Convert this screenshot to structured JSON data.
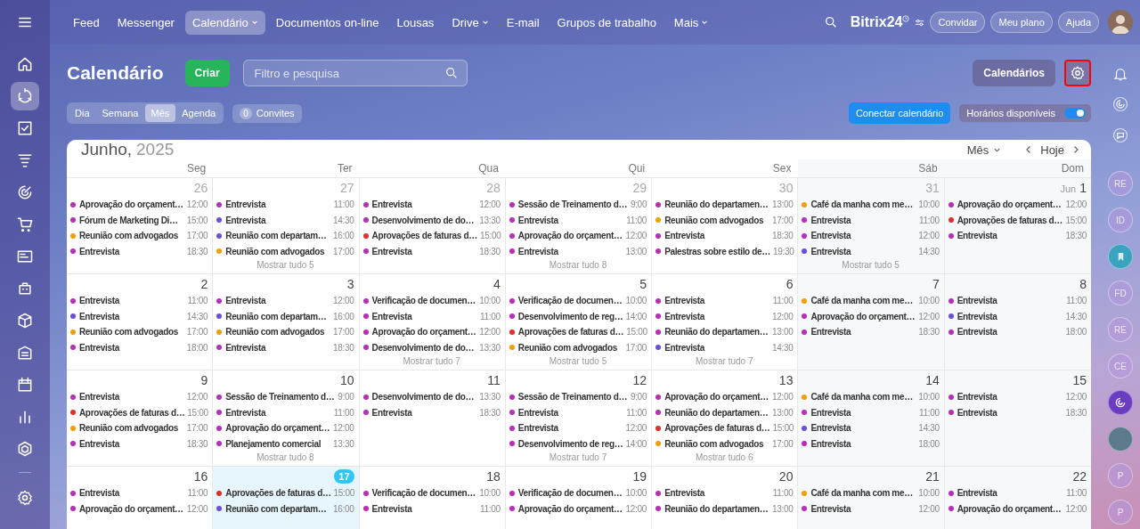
{
  "top_nav": {
    "items": [
      {
        "label": "Feed",
        "selected": false,
        "dropdown": false
      },
      {
        "label": "Messenger",
        "selected": false,
        "dropdown": false
      },
      {
        "label": "Calendário",
        "selected": true,
        "dropdown": true
      },
      {
        "label": "Documentos on-line",
        "selected": false,
        "dropdown": false
      },
      {
        "label": "Lousas",
        "selected": false,
        "dropdown": false
      },
      {
        "label": "Drive",
        "selected": false,
        "dropdown": true
      },
      {
        "label": "E-mail",
        "selected": false,
        "dropdown": false
      },
      {
        "label": "Grupos de trabalho",
        "selected": false,
        "dropdown": false
      },
      {
        "label": "Mais",
        "selected": false,
        "dropdown": true
      }
    ]
  },
  "logo": {
    "name": "Bitrix",
    "suffix": "24"
  },
  "header_buttons": [
    "Convidar",
    "Meu plano",
    "Ajuda"
  ],
  "left_sidebar": {
    "items": [
      {
        "selected": false
      },
      {
        "selected": true
      },
      {
        "selected": false
      },
      {
        "selected": false
      },
      {
        "selected": false
      },
      {
        "selected": false
      },
      {
        "selected": false
      },
      {
        "selected": false
      },
      {
        "selected": false
      },
      {
        "selected": false
      },
      {
        "selected": false
      },
      {
        "selected": false
      },
      {
        "selected": false
      }
    ]
  },
  "page": {
    "title": "Calendário",
    "create_button": "Criar",
    "search": {
      "placeholder": "Filtro e pesquisa"
    },
    "calendars_button": "Calendários",
    "views": [
      {
        "label": "Dia",
        "selected": false
      },
      {
        "label": "Semana",
        "selected": false
      },
      {
        "label": "Mês",
        "selected": true
      },
      {
        "label": "Agenda",
        "selected": false
      }
    ],
    "invites": {
      "count": "0",
      "label": "Convites"
    },
    "connect_button": "Conectar calendário",
    "availability": {
      "label": "Horários disponíveis",
      "on": true
    }
  },
  "calendar": {
    "month": "Junho,",
    "year": "2025",
    "view_select": "Mês",
    "today_button": "Hoje",
    "weekdays": [
      "Seg",
      "Ter",
      "Qua",
      "Qui",
      "Sex",
      "Sáb",
      "Dom"
    ],
    "weeks": [
      {
        "days": [
          {
            "date": "26",
            "other_month": true,
            "today": false,
            "events": [
              {
                "title": "Aprovação do orçament…",
                "time": "12:00",
                "color": "#b62fb8"
              },
              {
                "title": "Fórum de Marketing Di…",
                "time": "15:00",
                "color": "#b62fb8"
              },
              {
                "title": "Reunião com advogados",
                "time": "17:00",
                "color": "#f0a000"
              },
              {
                "title": "Entrevista",
                "time": "18:30",
                "color": "#b62fb8"
              }
            ]
          },
          {
            "date": "27",
            "other_month": true,
            "today": false,
            "events": [
              {
                "title": "Entrevista",
                "time": "11:00",
                "color": "#b62fb8"
              },
              {
                "title": "Entrevista",
                "time": "14:30",
                "color": "#6a4fd8"
              },
              {
                "title": "Reunião com departam…",
                "time": "16:00",
                "color": "#6a4fd8"
              },
              {
                "title": "Reunião com advogados",
                "time": "17:00",
                "color": "#f0a000"
              }
            ],
            "more": "Mostrar tudo 5"
          },
          {
            "date": "28",
            "other_month": true,
            "today": false,
            "events": [
              {
                "title": "Entrevista",
                "time": "12:00",
                "color": "#b62fb8"
              },
              {
                "title": "Desenvolvimento de do…",
                "time": "13:30",
                "color": "#b62fb8"
              },
              {
                "title": "Aprovações de faturas d…",
                "time": "15:00",
                "color": "#e0302a"
              },
              {
                "title": "Entrevista",
                "time": "18:30",
                "color": "#b62fb8"
              }
            ]
          },
          {
            "date": "29",
            "other_month": true,
            "today": false,
            "events": [
              {
                "title": "Sessão de Treinamento d…",
                "time": "9:00",
                "color": "#b62fb8"
              },
              {
                "title": "Entrevista",
                "time": "11:00",
                "color": "#b62fb8"
              },
              {
                "title": "Aprovação do orçament…",
                "time": "12:00",
                "color": "#b62fb8"
              },
              {
                "title": "Entrevista",
                "time": "13:00",
                "color": "#b62fb8"
              }
            ],
            "more": "Mostrar tudo 8"
          },
          {
            "date": "30",
            "other_month": true,
            "today": false,
            "events": [
              {
                "title": "Reunião do departamen…",
                "time": "13:00",
                "color": "#b62fb8"
              },
              {
                "title": "Reunião com advogados",
                "time": "17:00",
                "color": "#f0a000"
              },
              {
                "title": "Entrevista",
                "time": "18:30",
                "color": "#b62fb8"
              },
              {
                "title": "Palestras sobre estilo de…",
                "time": "19:30",
                "color": "#b62fb8"
              }
            ]
          },
          {
            "date": "31",
            "other_month": true,
            "today": false,
            "events": [
              {
                "title": "Café da manha com me…",
                "time": "10:00",
                "color": "#f0a000"
              },
              {
                "title": "Entrevista",
                "time": "11:00",
                "color": "#b62fb8"
              },
              {
                "title": "Entrevista",
                "time": "12:00",
                "color": "#b62fb8"
              },
              {
                "title": "Entrevista",
                "time": "14:30",
                "color": "#6a4fd8"
              }
            ],
            "more": "Mostrar tudo 5"
          },
          {
            "month_label": "Jun",
            "date": "1",
            "other_month": false,
            "today": false,
            "events": [
              {
                "title": "Aprovação do orçament…",
                "time": "12:00",
                "color": "#b62fb8"
              },
              {
                "title": "Aprovações de faturas d…",
                "time": "15:00",
                "color": "#e0302a"
              },
              {
                "title": "Entrevista",
                "time": "18:30",
                "color": "#b62fb8"
              }
            ]
          }
        ]
      },
      {
        "days": [
          {
            "date": "2",
            "other_month": false,
            "today": false,
            "events": [
              {
                "title": "Entrevista",
                "time": "11:00",
                "color": "#b62fb8"
              },
              {
                "title": "Entrevista",
                "time": "14:30",
                "color": "#6a4fd8"
              },
              {
                "title": "Reunião com advogados",
                "time": "17:00",
                "color": "#f0a000"
              },
              {
                "title": "Entrevista",
                "time": "18:00",
                "color": "#b62fb8"
              }
            ]
          },
          {
            "date": "3",
            "other_month": false,
            "today": false,
            "events": [
              {
                "title": "Entrevista",
                "time": "12:00",
                "color": "#b62fb8"
              },
              {
                "title": "Reunião com departam…",
                "time": "16:00",
                "color": "#6a4fd8"
              },
              {
                "title": "Reunião com advogados",
                "time": "17:00",
                "color": "#f0a000"
              },
              {
                "title": "Entrevista",
                "time": "18:30",
                "color": "#b62fb8"
              }
            ]
          },
          {
            "date": "4",
            "other_month": false,
            "today": false,
            "events": [
              {
                "title": "Verificação de documen…",
                "time": "10:00",
                "color": "#b62fb8"
              },
              {
                "title": "Entrevista",
                "time": "11:00",
                "color": "#b62fb8"
              },
              {
                "title": "Aprovação do orçament…",
                "time": "12:00",
                "color": "#b62fb8"
              },
              {
                "title": "Desenvolvimento de do…",
                "time": "13:30",
                "color": "#b62fb8"
              }
            ],
            "more": "Mostrar tudo 7"
          },
          {
            "date": "5",
            "other_month": false,
            "today": false,
            "events": [
              {
                "title": "Verificação de documen…",
                "time": "10:00",
                "color": "#b62fb8"
              },
              {
                "title": "Desenvolvimento de reg…",
                "time": "14:00",
                "color": "#b62fb8"
              },
              {
                "title": "Aprovações de faturas d…",
                "time": "15:00",
                "color": "#e0302a"
              },
              {
                "title": "Reunião com advogados",
                "time": "17:00",
                "color": "#f0a000"
              }
            ],
            "more": "Mostrar tudo 5"
          },
          {
            "date": "6",
            "other_month": false,
            "today": false,
            "events": [
              {
                "title": "Entrevista",
                "time": "11:00",
                "color": "#b62fb8"
              },
              {
                "title": "Entrevista",
                "time": "12:00",
                "color": "#b62fb8"
              },
              {
                "title": "Reunião do departamen…",
                "time": "13:00",
                "color": "#b62fb8"
              },
              {
                "title": "Entrevista",
                "time": "14:30",
                "color": "#6a4fd8"
              }
            ],
            "more": "Mostrar tudo 7"
          },
          {
            "date": "7",
            "other_month": false,
            "today": false,
            "events": [
              {
                "title": "Café da manha com me…",
                "time": "10:00",
                "color": "#f0a000"
              },
              {
                "title": "Aprovação do orçament…",
                "time": "12:00",
                "color": "#b62fb8"
              },
              {
                "title": "Entrevista",
                "time": "18:30",
                "color": "#b62fb8"
              }
            ]
          },
          {
            "date": "8",
            "other_month": false,
            "today": false,
            "events": [
              {
                "title": "Entrevista",
                "time": "11:00",
                "color": "#b62fb8"
              },
              {
                "title": "Entrevista",
                "time": "14:30",
                "color": "#6a4fd8"
              },
              {
                "title": "Entrevista",
                "time": "18:00",
                "color": "#b62fb8"
              }
            ]
          }
        ]
      },
      {
        "days": [
          {
            "date": "9",
            "other_month": false,
            "today": false,
            "events": [
              {
                "title": "Entrevista",
                "time": "12:00",
                "color": "#b62fb8"
              },
              {
                "title": "Aprovações de faturas d…",
                "time": "15:00",
                "color": "#e0302a"
              },
              {
                "title": "Reunião com advogados",
                "time": "17:00",
                "color": "#f0a000"
              },
              {
                "title": "Entrevista",
                "time": "18:30",
                "color": "#b62fb8"
              }
            ]
          },
          {
            "date": "10",
            "other_month": false,
            "today": false,
            "events": [
              {
                "title": "Sessão de Treinamento d…",
                "time": "9:00",
                "color": "#b62fb8"
              },
              {
                "title": "Entrevista",
                "time": "11:00",
                "color": "#b62fb8"
              },
              {
                "title": "Aprovação do orçament…",
                "time": "12:00",
                "color": "#b62fb8"
              },
              {
                "title": "Planejamento comercial",
                "time": "13:30",
                "color": "#b62fb8"
              }
            ],
            "more": "Mostrar tudo 8"
          },
          {
            "date": "11",
            "other_month": false,
            "today": false,
            "events": [
              {
                "title": "Desenvolvimento de do…",
                "time": "13:30",
                "color": "#b62fb8"
              },
              {
                "title": "Entrevista",
                "time": "18:30",
                "color": "#b62fb8"
              }
            ]
          },
          {
            "date": "12",
            "other_month": false,
            "today": false,
            "events": [
              {
                "title": "Sessão de Treinamento d…",
                "time": "9:00",
                "color": "#b62fb8"
              },
              {
                "title": "Entrevista",
                "time": "11:00",
                "color": "#b62fb8"
              },
              {
                "title": "Entrevista",
                "time": "12:00",
                "color": "#b62fb8"
              },
              {
                "title": "Desenvolvimento de reg…",
                "time": "14:00",
                "color": "#b62fb8"
              }
            ],
            "more": "Mostrar tudo 7"
          },
          {
            "date": "13",
            "other_month": false,
            "today": false,
            "events": [
              {
                "title": "Aprovação do orçament…",
                "time": "12:00",
                "color": "#b62fb8"
              },
              {
                "title": "Reunião do departamen…",
                "time": "13:00",
                "color": "#b62fb8"
              },
              {
                "title": "Aprovações de faturas d…",
                "time": "15:00",
                "color": "#e0302a"
              },
              {
                "title": "Reunião com advogados",
                "time": "17:00",
                "color": "#f0a000"
              }
            ],
            "more": "Mostrar tudo 6"
          },
          {
            "date": "14",
            "other_month": false,
            "today": false,
            "events": [
              {
                "title": "Café da manha com me…",
                "time": "10:00",
                "color": "#f0a000"
              },
              {
                "title": "Entrevista",
                "time": "11:00",
                "color": "#b62fb8"
              },
              {
                "title": "Entrevista",
                "time": "14:30",
                "color": "#6a4fd8"
              },
              {
                "title": "Entrevista",
                "time": "18:00",
                "color": "#b62fb8"
              }
            ]
          },
          {
            "date": "15",
            "other_month": false,
            "today": false,
            "events": [
              {
                "title": "Entrevista",
                "time": "12:00",
                "color": "#b62fb8"
              },
              {
                "title": "Entrevista",
                "time": "18:30",
                "color": "#b62fb8"
              }
            ]
          }
        ]
      },
      {
        "days": [
          {
            "date": "16",
            "other_month": false,
            "today": false,
            "events": [
              {
                "title": "Entrevista",
                "time": "11:00",
                "color": "#b62fb8"
              },
              {
                "title": "Aprovação do orçament…",
                "time": "12:00",
                "color": "#b62fb8"
              }
            ]
          },
          {
            "date": "17",
            "other_month": false,
            "today": true,
            "events": [
              {
                "title": "Aprovações de faturas d…",
                "time": "15:00",
                "color": "#e0302a"
              },
              {
                "title": "Reunião com departam…",
                "time": "16:00",
                "color": "#6a4fd8"
              }
            ]
          },
          {
            "date": "18",
            "other_month": false,
            "today": false,
            "events": [
              {
                "title": "Verificação de documen…",
                "time": "10:00",
                "color": "#b62fb8"
              },
              {
                "title": "Entrevista",
                "time": "11:00",
                "color": "#b62fb8"
              }
            ]
          },
          {
            "date": "19",
            "other_month": false,
            "today": false,
            "events": [
              {
                "title": "Verificação de documen…",
                "time": "10:00",
                "color": "#b62fb8"
              },
              {
                "title": "Aprovação do orçament…",
                "time": "12:00",
                "color": "#b62fb8"
              }
            ]
          },
          {
            "date": "20",
            "other_month": false,
            "today": false,
            "events": [
              {
                "title": "Entrevista",
                "time": "11:00",
                "color": "#b62fb8"
              },
              {
                "title": "Reunião do departamen…",
                "time": "13:00",
                "color": "#b62fb8"
              }
            ]
          },
          {
            "date": "21",
            "other_month": false,
            "today": false,
            "events": [
              {
                "title": "Café da manha com me…",
                "time": "10:00",
                "color": "#f0a000"
              },
              {
                "title": "Entrevista",
                "time": "12:00",
                "color": "#b62fb8"
              }
            ]
          },
          {
            "date": "22",
            "other_month": false,
            "today": false,
            "events": [
              {
                "title": "Entrevista",
                "time": "11:00",
                "color": "#b62fb8"
              },
              {
                "title": "Aprovação do orçament…",
                "time": "12:00",
                "color": "#b62fb8"
              }
            ]
          }
        ]
      }
    ]
  },
  "right_rail": {
    "contacts": [
      {
        "kind": "initials",
        "label": "RE"
      },
      {
        "kind": "initials",
        "label": "ID"
      },
      {
        "kind": "bookmark"
      },
      {
        "kind": "initials",
        "label": "FD"
      },
      {
        "kind": "initials",
        "label": "RE"
      },
      {
        "kind": "initials",
        "label": "CE"
      },
      {
        "kind": "activity"
      },
      {
        "kind": "photo"
      },
      {
        "kind": "initials",
        "label": "P"
      },
      {
        "kind": "initials",
        "label": "P"
      }
    ]
  }
}
